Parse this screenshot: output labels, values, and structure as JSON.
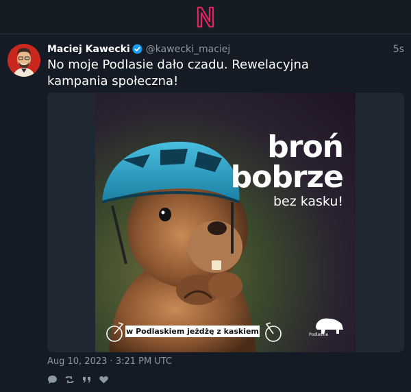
{
  "app": {
    "logo_letter": "N"
  },
  "tweet": {
    "display_name": "Maciej Kawecki",
    "handle": "@kawecki_maciej",
    "time_ago": "5s",
    "text": "No moje Podlasie dało czadu. Rewelacyjna kampania społeczna!",
    "timestamp": "Aug 10, 2023 · 3:21 PM UTC",
    "media": {
      "headline_line1": "broń",
      "headline_line2": "bobrze",
      "headline_line3": "bez kasku!",
      "banner": "w Podlaskiem jeżdżę z kaskiem",
      "brand": "Podlaskie"
    },
    "actions": [
      "reply-icon",
      "retweet-icon",
      "quote-icon",
      "like-icon"
    ]
  },
  "colors": {
    "background": "#0f1419",
    "accent": "#1d9bf0",
    "logo": "#e0245e",
    "muted": "#8b98a5"
  }
}
